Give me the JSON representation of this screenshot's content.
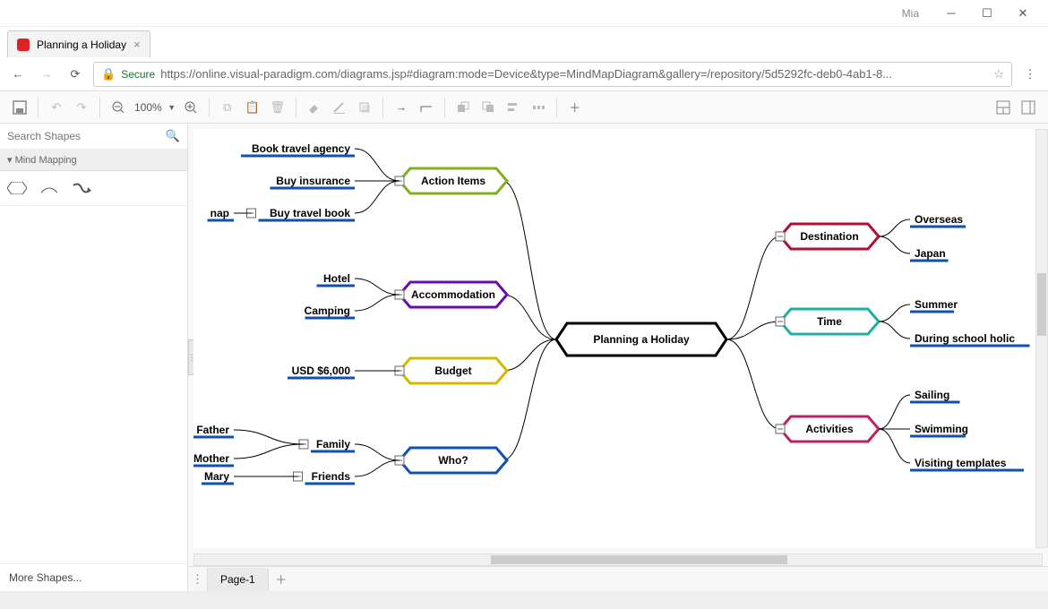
{
  "window": {
    "user": "Mia"
  },
  "tab": {
    "title": "Planning a Holiday"
  },
  "address": {
    "secure_label": "Secure",
    "url": "https://online.visual-paradigm.com/diagrams.jsp#diagram:mode=Device&type=MindMapDiagram&gallery=/repository/5d5292fc-deb0-4ab1-8..."
  },
  "toolbar": {
    "zoom": "100%"
  },
  "sidebar": {
    "search_placeholder": "Search Shapes",
    "palette_header": "Mind Mapping",
    "more_shapes": "More Shapes..."
  },
  "page": {
    "name": "Page-1"
  },
  "mindmap": {
    "root": "Planning a Holiday",
    "left_branches": [
      {
        "label": "Action Items",
        "color": "#80b020",
        "children": [
          "Book travel agency",
          "Buy insurance",
          "Buy travel book"
        ],
        "grandchildren": {
          "Buy travel book": [
            "nap"
          ]
        }
      },
      {
        "label": "Accommodation",
        "color": "#6a0dad",
        "children": [
          "Hotel",
          "Camping"
        ]
      },
      {
        "label": "Budget",
        "color": "#d4b800",
        "children": [
          "USD $6,000"
        ]
      },
      {
        "label": "Who?",
        "color": "#1050b0",
        "children": [
          "Family",
          "Friends"
        ],
        "grandchildren": {
          "Family": [
            "Father",
            "Mother"
          ],
          "Friends": [
            "Mary"
          ]
        }
      }
    ],
    "right_branches": [
      {
        "label": "Destination",
        "color": "#b01030",
        "children": [
          "Overseas",
          "Japan"
        ]
      },
      {
        "label": "Time",
        "color": "#20b0a0",
        "children": [
          "Summer",
          "During school holic"
        ]
      },
      {
        "label": "Activities",
        "color": "#c02060",
        "children": [
          "Sailing",
          "Swimming",
          "Visiting templates"
        ]
      }
    ]
  }
}
